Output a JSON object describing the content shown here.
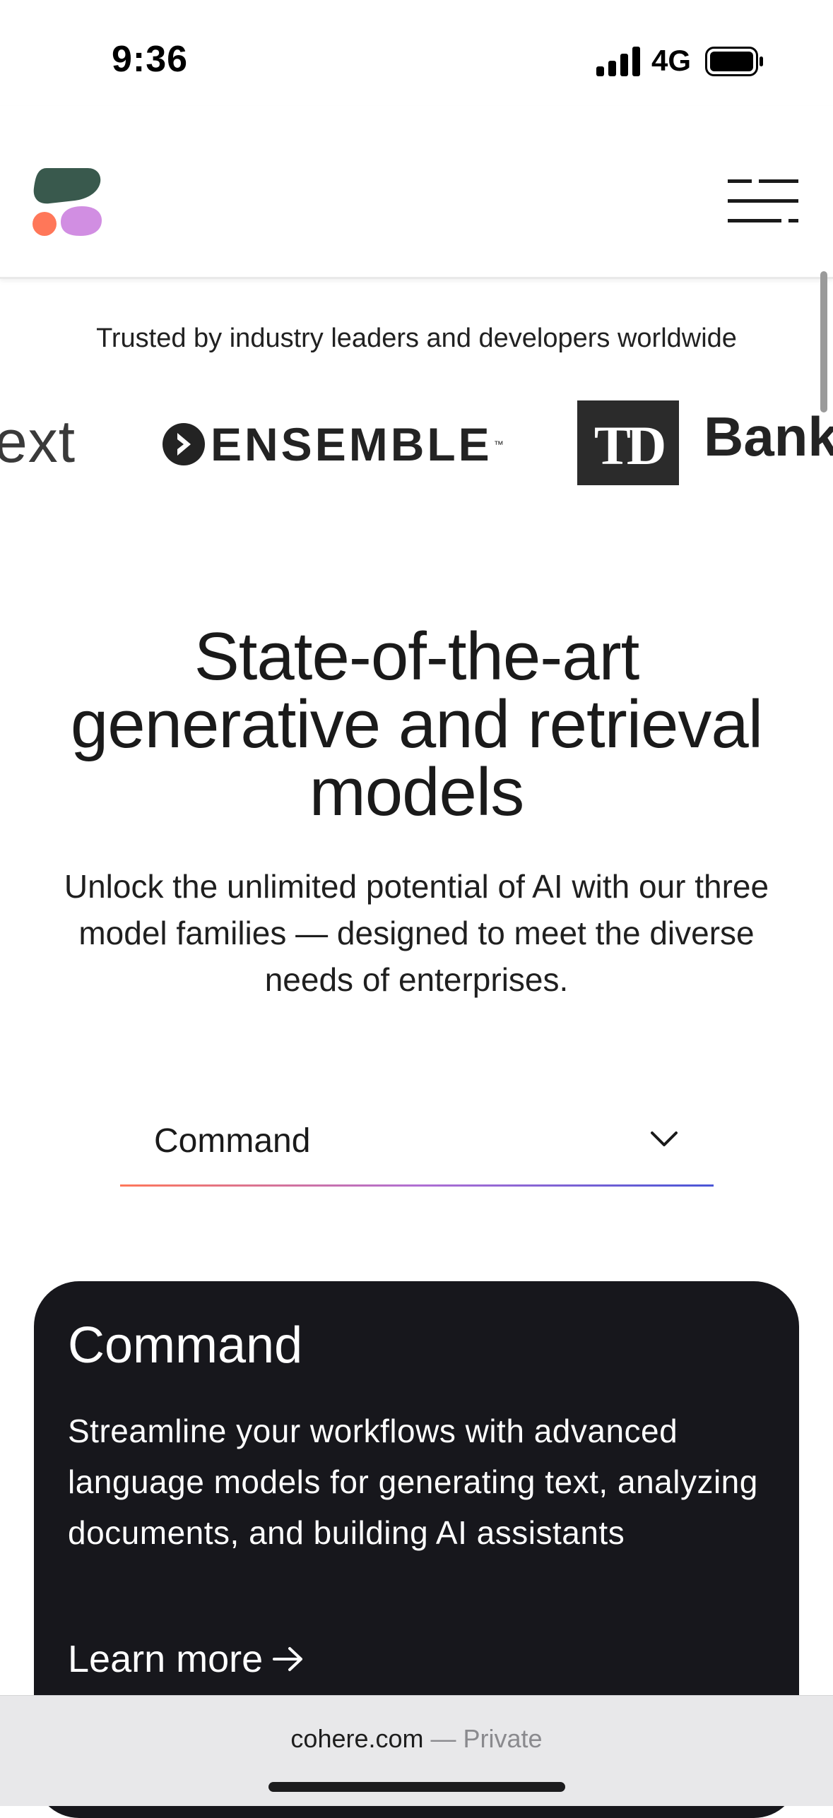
{
  "status_bar": {
    "time": "9:36",
    "network": "4G",
    "icons": [
      "signal-icon",
      "battery-icon"
    ]
  },
  "header": {
    "logo_icon": "cohere-logo",
    "menu_icon": "hamburger-menu-icon",
    "logo_colors": [
      "#39594d",
      "#ff7759",
      "#d18ee2"
    ]
  },
  "trusted": {
    "text": "Trusted by industry leaders and developers worldwide",
    "logos": {
      "partial_left": "ext",
      "ensemble": "ENSEMBLE",
      "ensemble_tm": "™",
      "td": "TD",
      "bank": "Bank"
    }
  },
  "hero": {
    "title_line_1": "State-of-the-art",
    "title_line_2": "generative and retrieval",
    "title_line_3": "models",
    "subtitle": "Unlock the unlimited potential of AI with our three model families — designed to meet the diverse needs of enterprises."
  },
  "model_select": {
    "value": "Command",
    "icon": "chevron-down-icon"
  },
  "card": {
    "title": "Command",
    "description": "Streamline your workflows with advanced language models for generating text, analyzing documents, and building AI assistants",
    "link_label": "Learn more",
    "link_icon": "arrow-right-icon"
  },
  "browser": {
    "domain": "cohere.com",
    "mode": " — Private"
  }
}
